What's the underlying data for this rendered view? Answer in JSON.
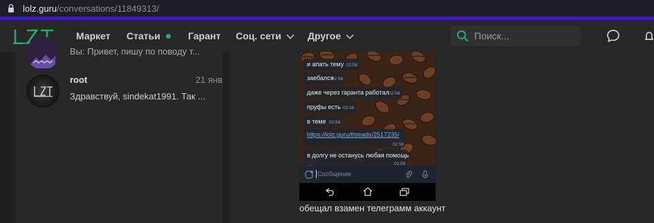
{
  "browser": {
    "url_host": "lolz.guru",
    "url_path": "/conversations/11849313/"
  },
  "nav": {
    "logo_text": "LZT",
    "items": [
      {
        "label": "Маркет"
      },
      {
        "label": "Статьи"
      },
      {
        "label": "Гарант"
      },
      {
        "label": "Соц. сети"
      },
      {
        "label": "Другое"
      }
    ],
    "search_placeholder": "Поиск...",
    "accent_color": "#2ba776"
  },
  "conversations": [
    {
      "name": "",
      "date": "",
      "preview": "Вы: Привет, пишу по поводу т..."
    },
    {
      "name": "root",
      "date": "21 янв",
      "preview": "Здравствуй, sindekat1991. Так ..."
    }
  ],
  "message": {
    "chat_screenshot": {
      "bubbles": [
        {
          "text": "и апать тему",
          "time": "02:58"
        },
        {
          "text": "заебался",
          "time": "02:58"
        },
        {
          "text": "даже через гаранта работал",
          "time": "02:58"
        },
        {
          "text": "пруфы есть",
          "time": "02:58"
        },
        {
          "text": "в теме",
          "time": "02:58"
        },
        {
          "text": "https://lolz.guru/threads/2517235/",
          "time": "02:58"
        },
        {
          "text": "в долгу не останусь любая помощь",
          "time": "02:59"
        }
      ],
      "composer_placeholder": "Сообщение"
    },
    "caption": "обещал взамен телеграмм аккаунт"
  }
}
